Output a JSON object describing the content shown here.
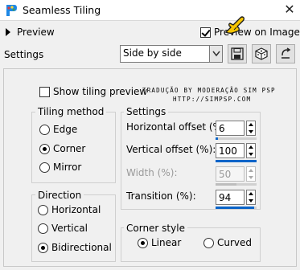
{
  "window": {
    "title": "Seamless Tiling",
    "close_glyph": "✕"
  },
  "top": {
    "preview_label": "Preview",
    "proof_on_image": {
      "label": "Preview on Image",
      "checked": true
    }
  },
  "settings_row": {
    "label": "Settings",
    "preset": "Side by side",
    "buttons": [
      "save-preset",
      "randomize",
      "reset"
    ]
  },
  "show_tiling_preview": {
    "label": "Show tiling preview",
    "checked": false
  },
  "credit": {
    "line1": "TRADUÇÃO BY MODERAÇÃO SIM PSP",
    "line2": "HTTP://SIMPSP.COM"
  },
  "tiling_method": {
    "title": "Tiling method",
    "options": [
      "Edge",
      "Corner",
      "Mirror"
    ],
    "selected": "Corner"
  },
  "direction": {
    "title": "Direction",
    "options": [
      "Horizontal",
      "Vertical",
      "Bidirectional"
    ],
    "selected": "Bidirectional"
  },
  "settings": {
    "title": "Settings",
    "fields": [
      {
        "label": "Horizontal offset (%):",
        "value": "6",
        "fraction": 0.06,
        "enabled": true
      },
      {
        "label": "Vertical offset (%):",
        "value": "100",
        "fraction": 1.0,
        "enabled": true
      },
      {
        "label": "Width (%):",
        "value": "50",
        "fraction": 0.5,
        "enabled": false
      },
      {
        "label": "Transition (%):",
        "value": "94",
        "fraction": 0.94,
        "enabled": true
      }
    ]
  },
  "corner_style": {
    "title": "Corner style",
    "options": [
      "Linear",
      "Curved"
    ],
    "selected": "Linear"
  },
  "colors": {
    "accent": "#0a64c8",
    "cursor": "#f5c400"
  }
}
